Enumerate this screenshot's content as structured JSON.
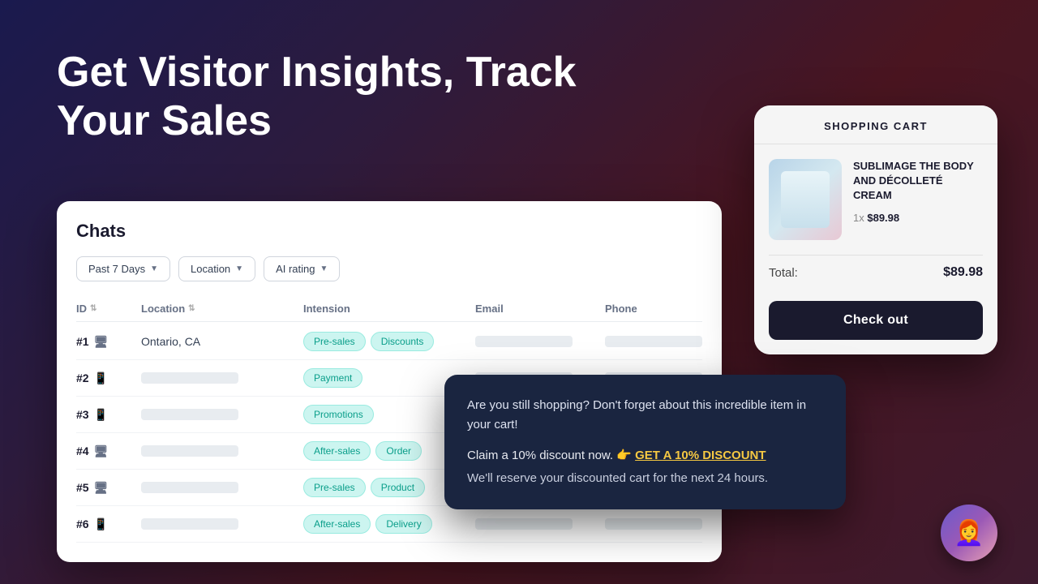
{
  "hero": {
    "title_line1": "Get Visitor Insights, Track",
    "title_line2": "Your Sales"
  },
  "chats": {
    "title": "Chats",
    "filters": [
      {
        "label": "Past 7 Days",
        "id": "filter-time"
      },
      {
        "label": "Location",
        "id": "filter-location"
      },
      {
        "label": "AI rating",
        "id": "filter-ai-rating"
      }
    ],
    "columns": [
      "ID",
      "Location",
      "Intension",
      "Email",
      "Phone"
    ],
    "rows": [
      {
        "id": "#1",
        "device": "desktop",
        "location": "Ontario, CA",
        "tags": [
          "Pre-sales",
          "Discounts"
        ],
        "has_email": false,
        "has_phone": false
      },
      {
        "id": "#2",
        "device": "mobile",
        "location": "",
        "tags": [
          "Payment"
        ],
        "has_email": true,
        "has_phone": true
      },
      {
        "id": "#3",
        "device": "mobile",
        "location": "",
        "tags": [
          "Promotions"
        ],
        "has_email": true,
        "has_phone": true
      },
      {
        "id": "#4",
        "device": "desktop",
        "location": "",
        "tags": [
          "After-sales",
          "Order"
        ],
        "has_email": true,
        "has_phone": true
      },
      {
        "id": "#5",
        "device": "desktop",
        "location": "",
        "tags": [
          "Pre-sales",
          "Product"
        ],
        "has_email": true,
        "has_phone": true
      },
      {
        "id": "#6",
        "device": "mobile",
        "location": "",
        "tags": [
          "After-sales",
          "Delivery"
        ],
        "has_email": true,
        "has_phone": true
      }
    ]
  },
  "cart": {
    "header": "SHOPPING CART",
    "item": {
      "name": "SUBLIMAGE THE BODY AND DÉCOLLETÉ CREAM",
      "qty": "1x",
      "price": "$89.98"
    },
    "total_label": "Total:",
    "total_amount": "$89.98",
    "checkout_label": "Check out"
  },
  "popup": {
    "main_text": "Are you still shopping? Don't forget about this incredible item in your cart!",
    "claim_text": "Claim a 10% discount now. 👉",
    "link_text": "GET A 10% DISCOUNT",
    "reserve_text": "We'll reserve your discounted cart for the next 24 hours."
  }
}
